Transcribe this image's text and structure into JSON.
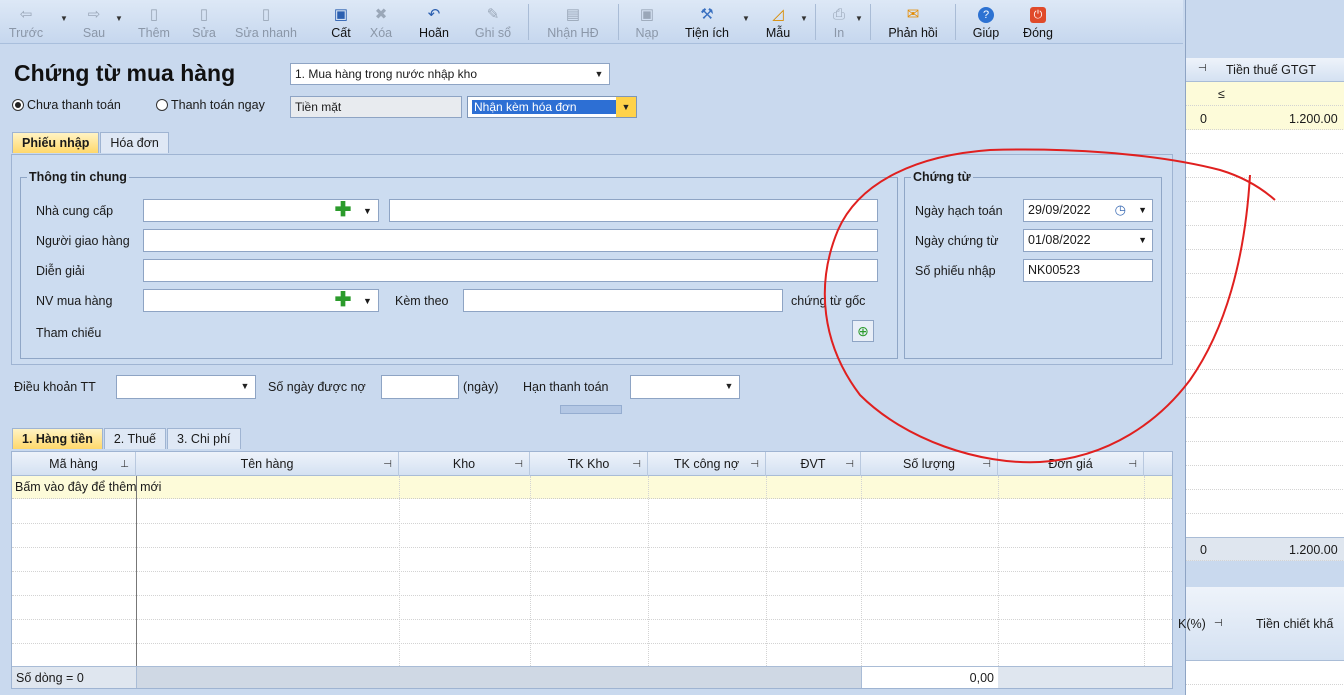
{
  "toolbar": {
    "items": [
      {
        "label": "Trước",
        "icon": "arrow-left-icon",
        "enabled": false
      },
      {
        "label": "Sau",
        "icon": "arrow-right-icon",
        "enabled": false
      },
      {
        "label": "Thêm",
        "icon": "add-doc-icon",
        "enabled": false
      },
      {
        "label": "Sửa",
        "icon": "edit-icon",
        "enabled": false
      },
      {
        "label": "Sửa nhanh",
        "icon": "quick-edit-icon",
        "enabled": false
      },
      {
        "label": "Cất",
        "icon": "save-icon",
        "enabled": true
      },
      {
        "label": "Xóa",
        "icon": "delete-icon",
        "enabled": false
      },
      {
        "label": "Hoãn",
        "icon": "undo-icon",
        "enabled": true
      },
      {
        "label": "Ghi sổ",
        "icon": "pen-icon",
        "enabled": false
      },
      {
        "label": "Nhận HĐ",
        "icon": "receive-invoice-icon",
        "enabled": false
      },
      {
        "label": "Nạp",
        "icon": "reload-icon",
        "enabled": false
      },
      {
        "label": "Tiện ích",
        "icon": "tools-icon",
        "enabled": true
      },
      {
        "label": "Mẫu",
        "icon": "template-icon",
        "enabled": true
      },
      {
        "label": "In",
        "icon": "print-icon",
        "enabled": false
      },
      {
        "label": "Phản hồi",
        "icon": "feedback-icon",
        "enabled": true
      },
      {
        "label": "Giúp",
        "icon": "help-icon",
        "enabled": true
      },
      {
        "label": "Đóng",
        "icon": "close-icon",
        "enabled": true
      }
    ]
  },
  "header": {
    "title": "Chứng từ mua hàng",
    "voucher_type": "1. Mua hàng trong nước nhập kho",
    "radio_unpaid": "Chưa thanh toán",
    "radio_paid_now": "Thanh toán ngay",
    "payment_method": "Tiền mặt",
    "invoice_option": "Nhận kèm hóa đơn"
  },
  "tabs_top": [
    "Phiếu nhập",
    "Hóa đơn"
  ],
  "general": {
    "title": "Thông tin chung",
    "supplier_label": "Nhà cung cấp",
    "deliverer_label": "Người giao hàng",
    "description_label": "Diễn giải",
    "buyer_label": "NV mua hàng",
    "attach_label": "Kèm theo",
    "original_docs_label": "chứng từ gốc",
    "reference_label": "Tham chiếu"
  },
  "voucher": {
    "title": "Chứng từ",
    "posting_date_label": "Ngày hạch toán",
    "posting_date": "29/09/2022",
    "voucher_date_label": "Ngày chứng từ",
    "voucher_date": "01/08/2022",
    "receipt_no_label": "Số phiếu nhập",
    "receipt_no": "NK00523"
  },
  "terms": {
    "payment_terms_label": "Điều khoản TT",
    "credit_days_label": "Số ngày được nợ",
    "days_unit": "(ngày)",
    "due_date_label": "Hạn thanh toán"
  },
  "tabs_bottom": [
    "1. Hàng tiền",
    "2. Thuế",
    "3. Chi phí"
  ],
  "grid": {
    "columns": [
      "Mã hàng",
      "Tên hàng",
      "Kho",
      "TK Kho",
      "TK công nợ",
      "ĐVT",
      "Số lượng",
      "Đơn giá"
    ],
    "add_new_text": "Bấm vào đây để thêm mới",
    "row_count_text": "Số dòng = 0",
    "total_qty": "0,00"
  },
  "right_panel": {
    "header_col": "Tiền thuế GTGT",
    "filter_symbol": "≤",
    "row_index": "0",
    "row_value": "1.200.00",
    "total_index": "0",
    "total_value": "1.200.00",
    "bottom_col1": "K(%)",
    "bottom_col2": "Tiền chiết khấ"
  },
  "annotation": {
    "color": "#e0201f"
  }
}
